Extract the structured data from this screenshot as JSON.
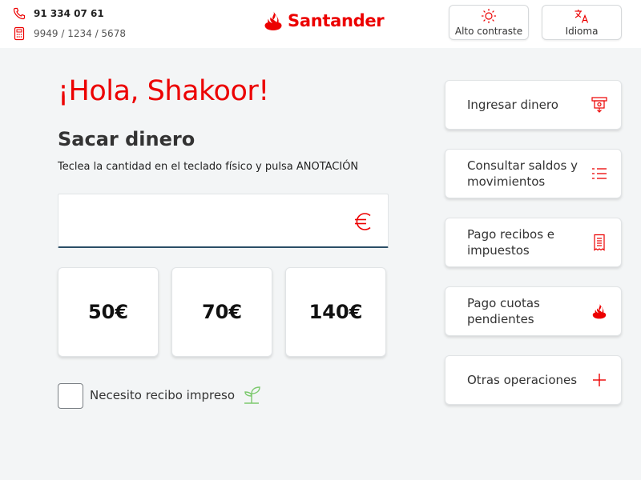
{
  "header": {
    "phone": "91 334 07 61",
    "account": "9949 / 1234 / 5678",
    "logo_text": "Santander",
    "contrast_label": "Alto contraste",
    "language_label": "Idioma"
  },
  "main": {
    "greeting": "¡Hola, Shakoor!",
    "title": "Sacar dinero",
    "instructions": "Teclea la cantidad en el teclado físico y pulsa ANOTACIÓN",
    "amount_value": "",
    "quick_amounts": [
      "50€",
      "70€",
      "140€"
    ],
    "receipt_label": "Necesito recibo impreso",
    "receipt_checked": false
  },
  "operations": [
    {
      "label": "Ingresar dinero",
      "icon": "deposit-icon"
    },
    {
      "label": "Consultar saldos y movimientos",
      "icon": "list-icon"
    },
    {
      "label": "Pago recibos e impuestos",
      "icon": "receipt-icon"
    },
    {
      "label": "Pago cuotas pendientes",
      "icon": "santander-flame-icon"
    },
    {
      "label": "Otras operaciones",
      "icon": "plus-icon"
    }
  ],
  "colors": {
    "brand_red": "#ec0000",
    "background": "#f3f5f6",
    "input_underline": "#2a4d66",
    "eco_green": "#7cc96e"
  }
}
